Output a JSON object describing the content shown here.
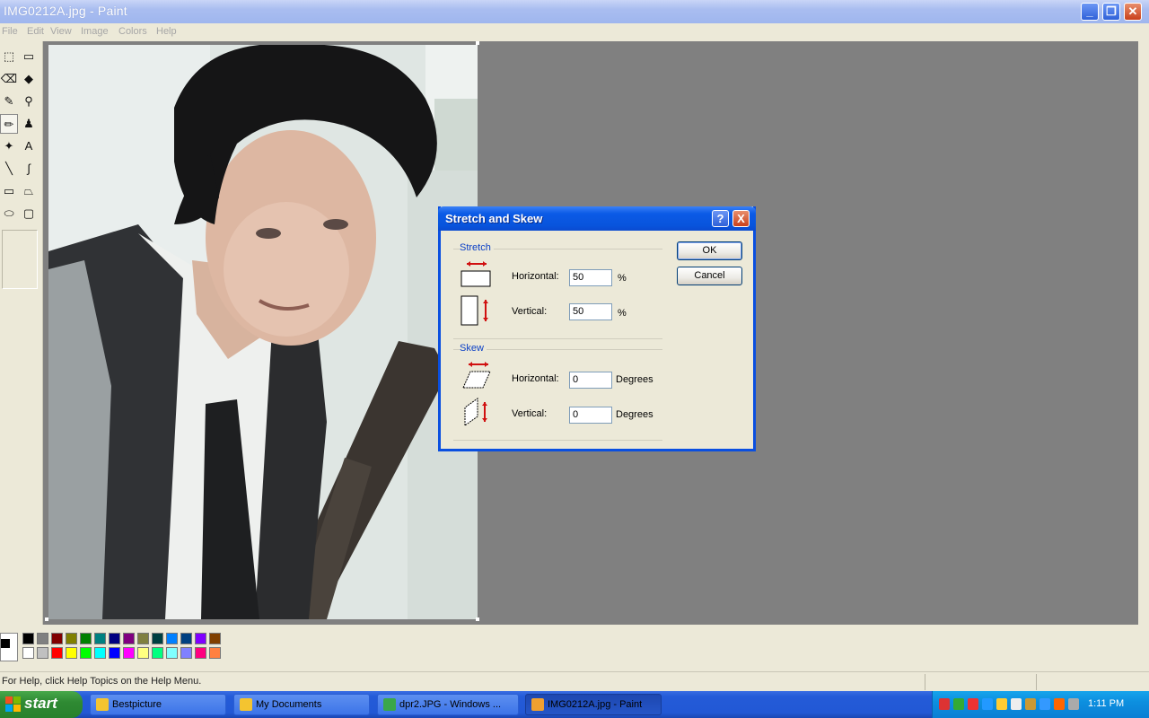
{
  "window": {
    "title": "IMG0212A.jpg - Paint",
    "buttons": {
      "minimize": "_",
      "maximize": "❐",
      "close": "✕"
    }
  },
  "menu": [
    "File",
    "Edit",
    "View",
    "Image",
    "Colors",
    "Help"
  ],
  "tools": [
    {
      "name": "free-form-select",
      "glyph": "⬚"
    },
    {
      "name": "select",
      "glyph": "▭"
    },
    {
      "name": "eraser",
      "glyph": "⌫"
    },
    {
      "name": "fill",
      "glyph": "◆"
    },
    {
      "name": "pick-color",
      "glyph": "✎"
    },
    {
      "name": "magnifier",
      "glyph": "⚲"
    },
    {
      "name": "pencil",
      "glyph": "✏"
    },
    {
      "name": "brush",
      "glyph": "♟"
    },
    {
      "name": "airbrush",
      "glyph": "✦"
    },
    {
      "name": "text",
      "glyph": "A"
    },
    {
      "name": "line",
      "glyph": "╲"
    },
    {
      "name": "curve",
      "glyph": "∫"
    },
    {
      "name": "rectangle",
      "glyph": "▭"
    },
    {
      "name": "polygon",
      "glyph": "⏢"
    },
    {
      "name": "ellipse",
      "glyph": "⬭"
    },
    {
      "name": "rounded-rectangle",
      "glyph": "▢"
    }
  ],
  "palette": {
    "row1": [
      "#000000",
      "#808080",
      "#800000",
      "#808000",
      "#008000",
      "#008080",
      "#000080",
      "#800080",
      "#808040",
      "#004040",
      "#0080ff",
      "#004080",
      "#8000ff",
      "#804000"
    ],
    "row2": [
      "#ffffff",
      "#c0c0c0",
      "#ff0000",
      "#ffff00",
      "#00ff00",
      "#00ffff",
      "#0000ff",
      "#ff00ff",
      "#ffff80",
      "#00ff80",
      "#80ffff",
      "#8080ff",
      "#ff0080",
      "#ff8040"
    ],
    "primary": "#000000",
    "secondary": "#ffffff"
  },
  "status": {
    "text": "For Help, click Help Topics on the Help Menu."
  },
  "dialog": {
    "title": "Stretch and Skew",
    "help": "?",
    "close": "X",
    "stretch": {
      "group": "Stretch",
      "horizontal_label": "Horizontal:",
      "horizontal_value": "50",
      "vertical_label": "Vertical:",
      "vertical_value": "50",
      "unit": "%"
    },
    "skew": {
      "group": "Skew",
      "horizontal_label": "Horizontal:",
      "horizontal_value": "0",
      "vertical_label": "Vertical:",
      "vertical_value": "0",
      "unit": "Degrees"
    },
    "ok": "OK",
    "cancel": "Cancel"
  },
  "taskbar": {
    "start": "start",
    "tasks": [
      {
        "label": "Bestpicture",
        "icon_color": "#f4c430"
      },
      {
        "label": "My Documents",
        "icon_color": "#f4c430"
      },
      {
        "label": "dpr2.JPG - Windows ...",
        "icon_color": "#3aa74a"
      },
      {
        "label": "IMG0212A.jpg - Paint",
        "icon_color": "#f0a030"
      }
    ],
    "clock": "1:11 PM"
  }
}
